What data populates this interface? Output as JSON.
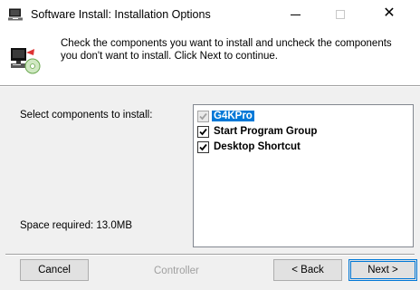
{
  "window": {
    "title": "Software Install: Installation Options",
    "minimize_symbol": "",
    "maximize_symbol": "",
    "close_symbol": "✕"
  },
  "header": {
    "description": "Check the components you want to install and uncheck the components you don't want to install. Click Next to continue.",
    "icon": "installer-computer-icon"
  },
  "body": {
    "select_label": "Select components to install:",
    "space_required": "Space required: 13.0MB",
    "components": [
      {
        "label": "G4KPro",
        "checked": true,
        "disabled": true,
        "selected": true
      },
      {
        "label": "Start Program Group",
        "checked": true,
        "disabled": false,
        "selected": false
      },
      {
        "label": "Desktop Shortcut",
        "checked": true,
        "disabled": false,
        "selected": false
      }
    ]
  },
  "footer": {
    "branding": "Controller",
    "cancel_label": "Cancel",
    "back_label": "< Back",
    "next_label": "Next >"
  },
  "colors": {
    "accent": "#0078d7",
    "dialog_bg": "#f0f0f0"
  }
}
